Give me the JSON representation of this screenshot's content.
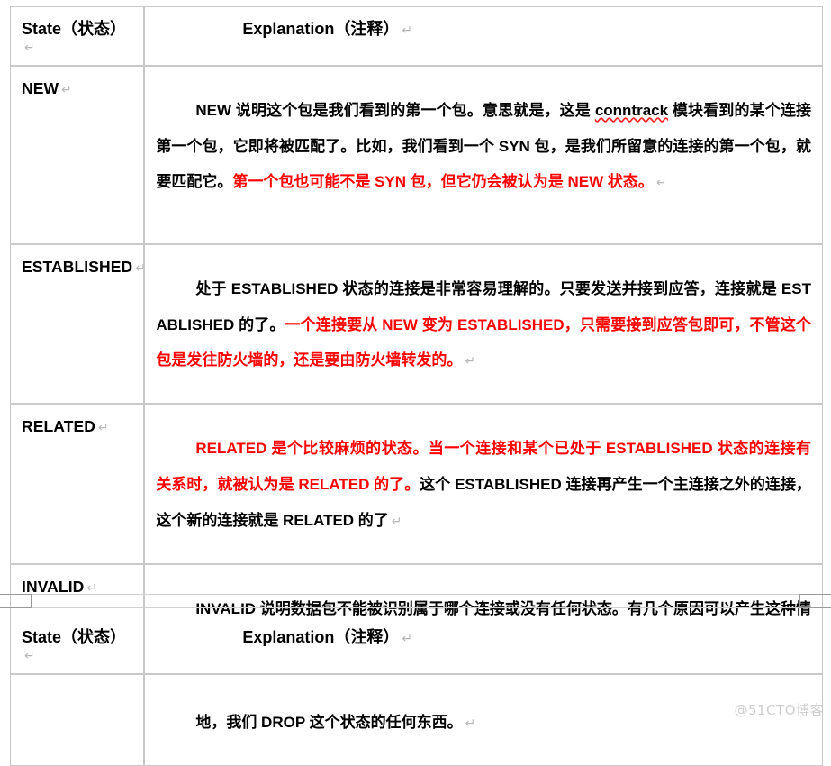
{
  "document": {
    "type": "word-document-table",
    "watermark": "@51CTO博客",
    "colors": {
      "text": "#000000",
      "highlight_red": "#ff0000",
      "table_border": "#c9c9c9",
      "pilcrow": "#b8b8b8",
      "watermark": "#cfcfcf"
    },
    "pilcrow_glyph": "↵"
  },
  "table_top": {
    "header": {
      "state": "State（状态）",
      "explanation": "Explanation（注释）"
    },
    "rows": [
      {
        "state": "NEW",
        "explanation_segments": [
          {
            "text": "NEW 说明这个包是我们看到的第一个包。意思就是，这是 ",
            "color": "black"
          },
          {
            "text": "conntrack",
            "color": "black",
            "misspelled": true
          },
          {
            "text": " 模块看到的某个连接第一个包，它即将被匹配了。比如，我们看到一个 SYN 包，是我们所留意的连接的第一个包，就要匹配它。",
            "color": "black"
          },
          {
            "text": "第一个包也可能不是 SYN 包，但它仍会被认为是 NEW 状态。",
            "color": "red"
          }
        ],
        "explanation_plain": "NEW 说明这个包是我们看到的第一个包。意思就是，这是 conntrack 模块看到的某个连接第一个包，它即将被匹配了。比如，我们看到一个 SYN 包，是我们所留意的连接的第一个包，就要匹配它。第一个包也可能不是 SYN 包，但它仍会被认为是 NEW 状态。"
      },
      {
        "state": "ESTABLISHED",
        "explanation_segments": [
          {
            "text": "处于 ESTABLISHED 状态的连接是非常容易理解的。只要发送并接到应答，连接就是 ESTABLISHED 的了。",
            "color": "black"
          },
          {
            "text": "一个连接要从 NEW 变为 ESTABLISHED，只需要接到应答包即可，不管这个包是发往防火墙的，还是要由防火墙转发的。",
            "color": "red"
          }
        ],
        "explanation_plain": "处于 ESTABLISHED 状态的连接是非常容易理解的。只要发送并接到应答，连接就是 ESTABLISHED 的了。一个连接要从 NEW 变为 ESTABLISHED，只需要接到应答包即可，不管这个包是发往防火墙的，还是要由防火墙转发的。"
      },
      {
        "state": "RELATED",
        "explanation_segments": [
          {
            "text": "RELATED 是个比较麻烦的状态。当一个连接和某个已处于 ESTABLISHED 状态的连接有关系时，就被认为是 RELATED 的了。",
            "color": "red"
          },
          {
            "text": "这个 ESTABLISHED 连接再产生一个主连接之外的连接，这个新的连接就是 RELATED 的了",
            "color": "black"
          }
        ],
        "explanation_plain": "RELATED 是个比较麻烦的状态。当一个连接和某个已处于 ESTABLISHED 状态的连接有关系时，就被认为是 RELATED 的了。这个 ESTABLISHED 连接再产生一个主连接之外的连接，这个新的连接就是 RELATED 的了"
      },
      {
        "state": "INVALID",
        "explanation_segments": [
          {
            "text": "INVALID 说明数据包不能被识别属于哪个连接或没有任何状态。有几个原因可以产生这种情况，比如，内存溢出，收到不知属于哪个连接的 ICMP 错误信息。一般",
            "color": "black"
          }
        ],
        "explanation_plain": "INVALID 说明数据包不能被识别属于哪个连接或没有任何状态。有几个原因可以产生这种情况，比如，内存溢出，收到不知属于哪个连接的 ICMP 错误信息。一般"
      }
    ]
  },
  "table_bottom": {
    "header": {
      "state": "State（状态）",
      "explanation": "Explanation（注释）"
    },
    "rows": [
      {
        "state": "",
        "explanation_segments": [
          {
            "text": "地，我们 DROP 这个状态的任何东西。",
            "color": "black"
          }
        ],
        "explanation_plain": "地，我们 DROP 这个状态的任何东西。"
      }
    ]
  }
}
